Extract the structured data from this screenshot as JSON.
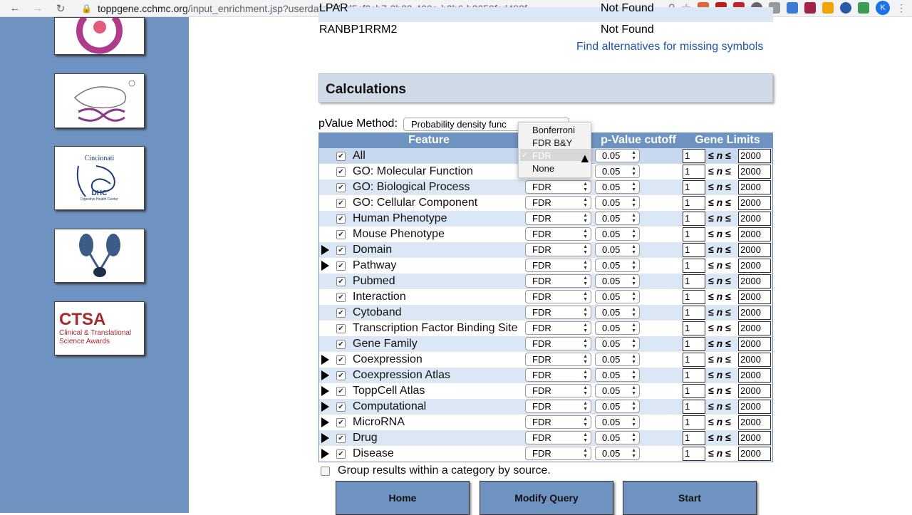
{
  "browser": {
    "url_host": "toppgene.cchmc.org",
    "url_path": "/input_enrichment.jsp?userdata_id=d5cf0cb7-3b23-400a-b3b6-b3059fcd482f",
    "profile_initial": "K"
  },
  "missing_symbols": [
    {
      "symbol": "LPAR",
      "status": "Not Found"
    },
    {
      "symbol": "RANBP1RRM2",
      "status": "Not Found"
    }
  ],
  "alternatives_link": "Find alternatives for missing symbols",
  "calculations": {
    "title": "Calculations",
    "pvalue_method_label": "pValue Method:",
    "pvalue_method_value": "Probability density func"
  },
  "table_headers": {
    "feature": "Feature",
    "pvalue_cutoff": "p-Value cutoff",
    "gene_limits": "Gene Limits"
  },
  "correction_dropdown": {
    "options": [
      "Bonferroni",
      "FDR B&Y",
      "FDR",
      "None"
    ],
    "selected": "FDR"
  },
  "features": [
    {
      "name": "All",
      "expandable": false,
      "correction": "",
      "cutoff": "0.05",
      "min": "1",
      "max": "2000"
    },
    {
      "name": "GO: Molecular Function",
      "expandable": false,
      "correction": "",
      "cutoff": "0.05",
      "min": "1",
      "max": "2000"
    },
    {
      "name": "GO: Biological Process",
      "expandable": false,
      "correction": "FDR",
      "cutoff": "0.05",
      "min": "1",
      "max": "2000"
    },
    {
      "name": "GO: Cellular Component",
      "expandable": false,
      "correction": "FDR",
      "cutoff": "0.05",
      "min": "1",
      "max": "2000"
    },
    {
      "name": "Human Phenotype",
      "expandable": false,
      "correction": "FDR",
      "cutoff": "0.05",
      "min": "1",
      "max": "2000"
    },
    {
      "name": "Mouse Phenotype",
      "expandable": false,
      "correction": "FDR",
      "cutoff": "0.05",
      "min": "1",
      "max": "2000"
    },
    {
      "name": "Domain",
      "expandable": true,
      "correction": "FDR",
      "cutoff": "0.05",
      "min": "1",
      "max": "2000"
    },
    {
      "name": "Pathway",
      "expandable": true,
      "correction": "FDR",
      "cutoff": "0.05",
      "min": "1",
      "max": "2000"
    },
    {
      "name": "Pubmed",
      "expandable": false,
      "correction": "FDR",
      "cutoff": "0.05",
      "min": "1",
      "max": "2000"
    },
    {
      "name": "Interaction",
      "expandable": false,
      "correction": "FDR",
      "cutoff": "0.05",
      "min": "1",
      "max": "2000"
    },
    {
      "name": "Cytoband",
      "expandable": false,
      "correction": "FDR",
      "cutoff": "0.05",
      "min": "1",
      "max": "2000"
    },
    {
      "name": "Transcription Factor Binding Site",
      "expandable": false,
      "correction": "FDR",
      "cutoff": "0.05",
      "min": "1",
      "max": "2000"
    },
    {
      "name": "Gene Family",
      "expandable": false,
      "correction": "FDR",
      "cutoff": "0.05",
      "min": "1",
      "max": "2000"
    },
    {
      "name": "Coexpression",
      "expandable": true,
      "correction": "FDR",
      "cutoff": "0.05",
      "min": "1",
      "max": "2000"
    },
    {
      "name": "Coexpression Atlas",
      "expandable": true,
      "correction": "FDR",
      "cutoff": "0.05",
      "min": "1",
      "max": "2000"
    },
    {
      "name": "ToppCell Atlas",
      "expandable": true,
      "correction": "FDR",
      "cutoff": "0.05",
      "min": "1",
      "max": "2000"
    },
    {
      "name": "Computational",
      "expandable": true,
      "correction": "FDR",
      "cutoff": "0.05",
      "min": "1",
      "max": "2000"
    },
    {
      "name": "MicroRNA",
      "expandable": true,
      "correction": "FDR",
      "cutoff": "0.05",
      "min": "1",
      "max": "2000"
    },
    {
      "name": "Drug",
      "expandable": true,
      "correction": "FDR",
      "cutoff": "0.05",
      "min": "1",
      "max": "2000"
    },
    {
      "name": "Disease",
      "expandable": true,
      "correction": "FDR",
      "cutoff": "0.05",
      "min": "1",
      "max": "2000"
    }
  ],
  "leq_symbol": "≤",
  "n_symbol": "n",
  "group_results_label": "Group results within a category by source.",
  "buttons": {
    "home": "Home",
    "modify": "Modify Query",
    "start": "Start"
  },
  "sidebar_logos": {
    "dhc_city": "Cincinnati",
    "dhc_abbr": "DHC",
    "dhc_name": "Digestive Health Center",
    "ctsa_abbr": "CTSA",
    "ctsa_line1": "Clinical & Translational",
    "ctsa_line2": "Science Awards"
  },
  "colors": {
    "sidebar": "#6f93c1",
    "row_even": "#dce7f5",
    "row_odd": "#ffffff",
    "link": "#1f56a8"
  }
}
